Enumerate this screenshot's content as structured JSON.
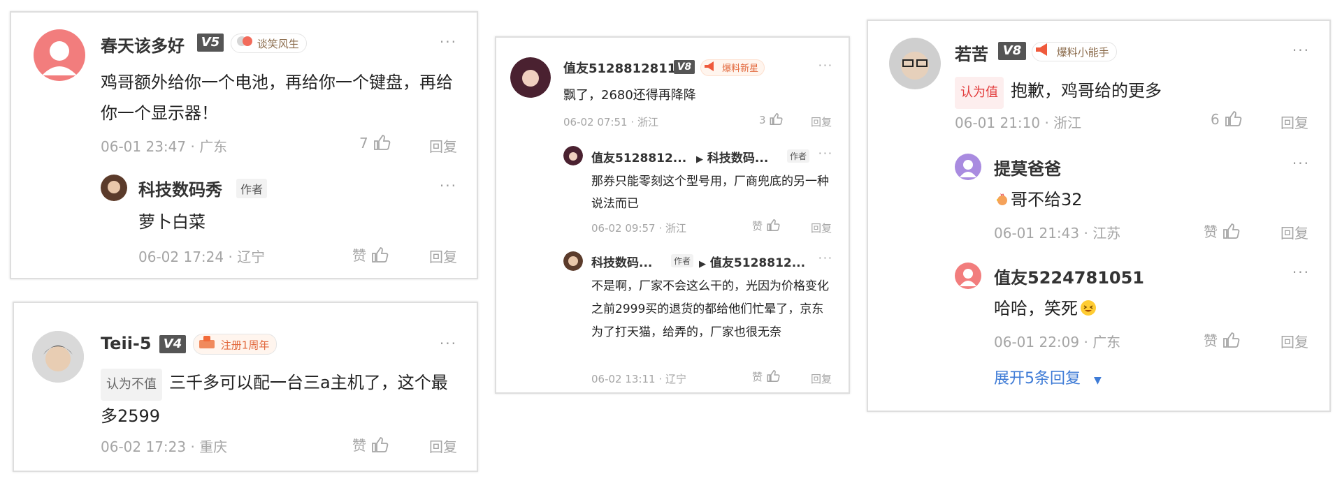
{
  "card1": {
    "user": "春天该多好",
    "level": "V5",
    "medal": "谈笑风生",
    "body": "鸡哥额外给你一个电池，再给你一个键盘，再给你一个显示器！",
    "time": "06-01 23:47",
    "loc": "广东",
    "likes": "7",
    "reply": "回复",
    "sub": {
      "user": "科技数码秀",
      "author": "作者",
      "body": "萝卜白菜",
      "time": "06-02 17:24",
      "loc": "辽宁",
      "likes": "赞",
      "reply": "回复"
    }
  },
  "card2": {
    "user": "Teii-5",
    "level": "V4",
    "medal": "注册1周年",
    "tag": "认为不值",
    "body": "三千多可以配一台三a主机了，这个最多2599",
    "time": "06-02 17:23",
    "loc": "重庆",
    "likes": "赞",
    "reply": "回复"
  },
  "card3": {
    "user": "值友5128812811",
    "level": "V8",
    "medal": "爆料新星",
    "body": "飘了，2680还得再降降",
    "time": "06-02 07:51",
    "loc": "浙江",
    "likes": "3",
    "reply": "回复",
    "sub1": {
      "user": "值友5128812...",
      "target": "科技数码...",
      "author": "作者",
      "body": "那券只能零刻这个型号用，厂商兜底的另一种说法而已",
      "time": "06-02 09:57",
      "loc": "浙江",
      "likes": "赞",
      "reply": "回复"
    },
    "sub2": {
      "user": "科技数码...",
      "author": "作者",
      "target": "值友5128812...",
      "body": "不是啊，厂家不会这么干的，光因为价格变化之前2999买的退货的都给他们忙晕了，京东为了打天猫，给弄的，厂家也很无奈",
      "time": "06-02 13:11",
      "loc": "辽宁",
      "likes": "赞",
      "reply": "回复"
    }
  },
  "card4": {
    "user": "若苦",
    "level": "V8",
    "medal": "爆料小能手",
    "tag": "认为值",
    "body": "抱歉，鸡哥给的更多",
    "time": "06-01 21:10",
    "loc": "浙江",
    "likes": "6",
    "reply": "回复",
    "sub1": {
      "user": "提莫爸爸",
      "body": "哥不给32",
      "time": "06-01 21:43",
      "loc": "江苏",
      "likes": "赞",
      "reply": "回复"
    },
    "sub2": {
      "user": "值友5224781051",
      "body": "哈哈，笑死",
      "time": "06-01 22:09",
      "loc": "广东",
      "likes": "赞",
      "reply": "回复"
    },
    "expand": "展开5条回复"
  },
  "sep": "·",
  "more": "···",
  "colors": {
    "link": "#3e7bd6",
    "tag_red": "#e23b3b",
    "badge": "#555555"
  }
}
